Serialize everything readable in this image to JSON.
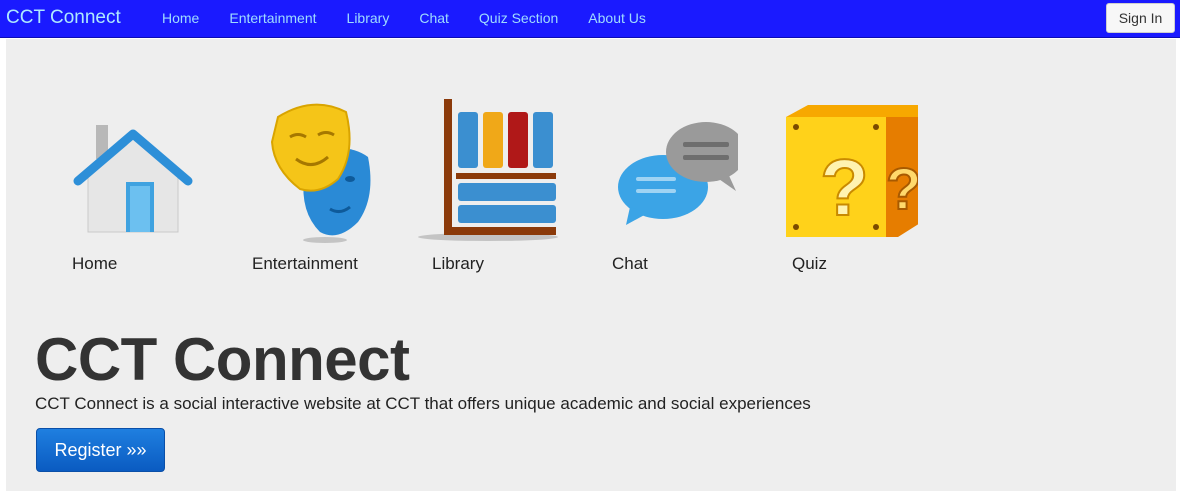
{
  "navbar": {
    "brand": "CCT Connect",
    "links": [
      "Home",
      "Entertainment",
      "Library",
      "Chat",
      "Quiz Section",
      "About Us"
    ],
    "signin": "Sign In",
    "color": "#1a1aff"
  },
  "tiles": [
    {
      "label": "Home",
      "icon": "house-icon"
    },
    {
      "label": "Entertainment",
      "icon": "theater-masks-icon"
    },
    {
      "label": "Library",
      "icon": "bookshelf-icon"
    },
    {
      "label": "Chat",
      "icon": "chat-bubbles-icon"
    },
    {
      "label": "Quiz",
      "icon": "question-block-icon"
    }
  ],
  "hero": {
    "title": "CCT Connect",
    "text": "CCT Connect is a social interactive website at CCT that offers unique academic and social experiences",
    "button": "Register »»"
  }
}
